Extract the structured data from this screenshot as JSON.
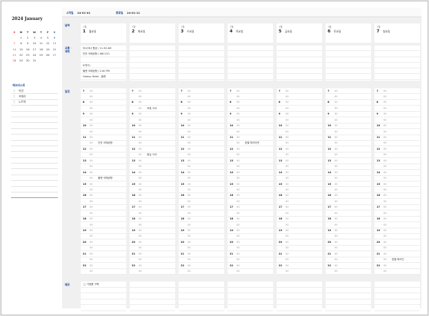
{
  "sidebar": {
    "year_title": "2024 January",
    "weekdays": [
      "S",
      "M",
      "T",
      "W",
      "T",
      "F",
      "S"
    ],
    "weeks": [
      [
        "",
        "1",
        "2",
        "3",
        "4",
        "5",
        "6"
      ],
      [
        "7",
        "8",
        "9",
        "10",
        "11",
        "12",
        "13"
      ],
      [
        "14",
        "15",
        "16",
        "17",
        "18",
        "19",
        "20"
      ],
      [
        "21",
        "22",
        "23",
        "24",
        "25",
        "26",
        "27"
      ],
      [
        "28",
        "29",
        "30",
        "31",
        "",
        "",
        ""
      ]
    ],
    "checklist_title": "체크리스트",
    "checklist": [
      "여권",
      "카메라",
      "노트북"
    ],
    "checkbox_glyph": "□"
  },
  "header": {
    "start_label": "시작일",
    "start_value": "24-01-01",
    "end_label": "종료일",
    "end_value": "24-01-11"
  },
  "labels": {
    "date": "날짜",
    "transport": "교통 · 계획",
    "schedule": "일정",
    "memo": "메모"
  },
  "minute_mark": "00",
  "days": [
    {
      "month": "1월",
      "day": "1",
      "dow": "월요일",
      "transport": [
        "아시아나 항공 / 11:30 AM",
        "인천 국제공항 / ABC123",
        "",
        "도착지 :",
        "올랜 국제공항 / 2:40 PM",
        "Galaxy Hotel - 올랜"
      ],
      "events": {
        "11": "인천 국제공항",
        "14": "올랜 국제공항"
      },
      "memo": [
        "□ 기념품 구매",
        "",
        "",
        "",
        ""
      ]
    },
    {
      "month": "1월",
      "day": "2",
      "dow": "화요일",
      "transport": [
        "",
        "",
        "",
        "",
        "",
        ""
      ],
      "events": {
        "8": "아침 식사",
        "12": "점심 식사"
      },
      "memo": [
        "",
        "",
        "",
        "",
        ""
      ]
    },
    {
      "month": "1월",
      "day": "3",
      "dow": "수요일",
      "transport": [
        "",
        "",
        "",
        "",
        "",
        ""
      ],
      "events": {},
      "memo": [
        "",
        "",
        "",
        "",
        ""
      ]
    },
    {
      "month": "1월",
      "day": "4",
      "dow": "목요일",
      "transport": [
        "",
        "",
        "",
        "",
        "",
        ""
      ],
      "events": {
        "11": "호텔 체크아웃"
      },
      "memo": [
        "",
        "",
        "",
        "",
        ""
      ]
    },
    {
      "month": "1월",
      "day": "5",
      "dow": "금요일",
      "transport": [
        "",
        "",
        "",
        "",
        "",
        ""
      ],
      "events": {},
      "memo": [
        "",
        "",
        "",
        "",
        ""
      ]
    },
    {
      "month": "1월",
      "day": "6",
      "dow": "토요일",
      "transport": [
        "",
        "",
        "",
        "",
        "",
        ""
      ],
      "events": {},
      "memo": [
        "",
        "",
        "",
        "",
        ""
      ]
    },
    {
      "month": "1월",
      "day": "7",
      "dow": "일요일",
      "transport": [
        "",
        "",
        "",
        "",
        "",
        ""
      ],
      "events": {
        "21": "호텔 체크인"
      },
      "memo": [
        "",
        "",
        "",
        "",
        ""
      ]
    }
  ],
  "hours": [
    "7",
    "8",
    "9",
    "10",
    "11",
    "12",
    "13",
    "14",
    "15",
    "16",
    "17",
    "18",
    "19",
    "20",
    "21",
    "22"
  ]
}
